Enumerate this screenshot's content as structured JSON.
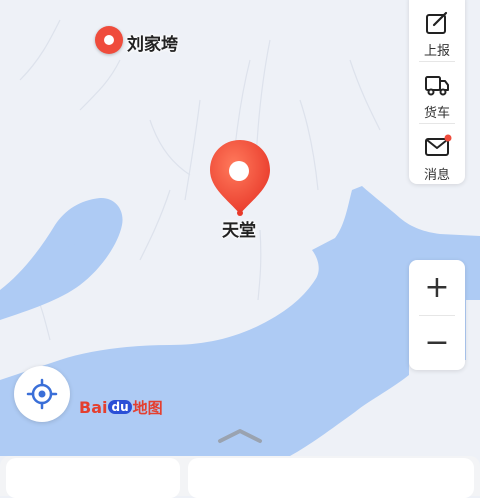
{
  "map": {
    "water_color": "#aecbf4",
    "land_color": "#eef1f7"
  },
  "places": {
    "village": "刘家垮",
    "selected": "天堂"
  },
  "toolbar": {
    "report_label": "上报",
    "truck_label": "货车",
    "message_label": "消息",
    "message_has_badge": true
  },
  "zoom": {
    "in_label": "+",
    "out_label": "−"
  },
  "logo": {
    "part1": "Bai",
    "part2": "du",
    "part3": "地图"
  },
  "colors": {
    "pin": "#ef4c3c",
    "accent": "#3a6fd8"
  }
}
